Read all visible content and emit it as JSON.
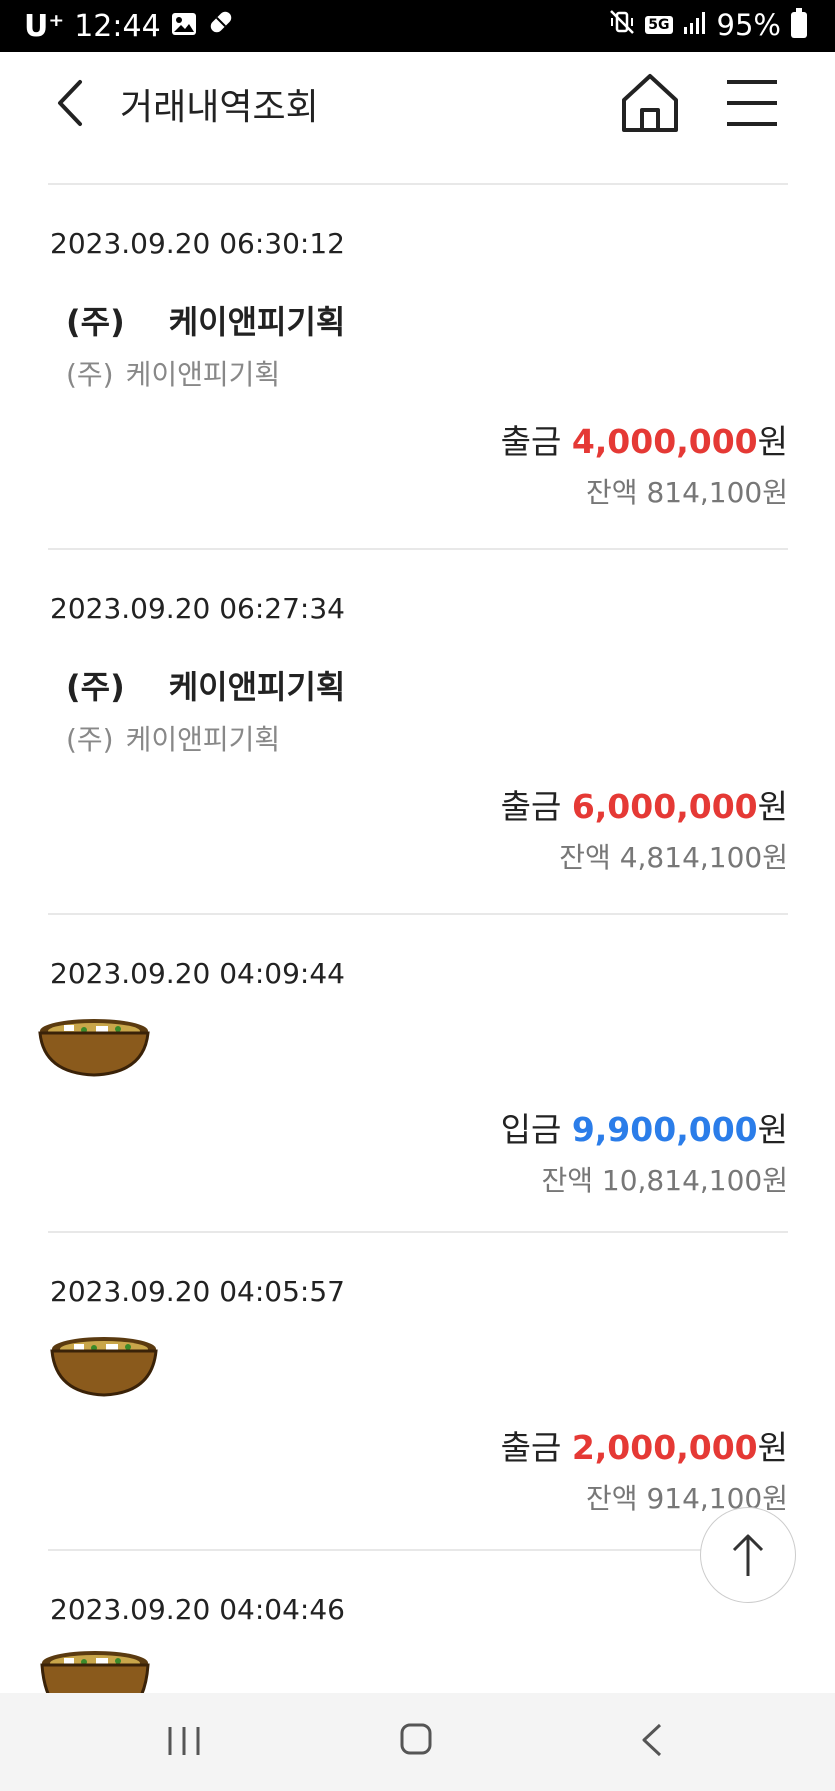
{
  "status_bar": {
    "carrier": "U⁺",
    "time": "12:44",
    "network": "5G",
    "battery": "95%"
  },
  "header": {
    "title": "거래내역조회"
  },
  "transactions": [
    {
      "datetime": "2023.09.20 06:30:12",
      "name_part1": "(주)",
      "name_part2": "케이앤피기획",
      "memo_part1": "(주)",
      "memo_part2": "케이앤피기획",
      "type": "출금",
      "amount": "4,000,000",
      "unit": "원",
      "balance_label": "잔액",
      "balance": "814,100",
      "balance_unit": "원"
    },
    {
      "datetime": "2023.09.20 06:27:34",
      "name_part1": "(주)",
      "name_part2": "케이앤피기획",
      "memo_part1": "(주)",
      "memo_part2": "케이앤피기획",
      "type": "출금",
      "amount": "6,000,000",
      "unit": "원",
      "balance_label": "잔액",
      "balance": "4,814,100",
      "balance_unit": "원"
    },
    {
      "datetime": "2023.09.20 04:09:44",
      "type": "입금",
      "amount": "9,900,000",
      "unit": "원",
      "balance_label": "잔액",
      "balance": "10,814,100",
      "balance_unit": "원"
    },
    {
      "datetime": "2023.09.20 04:05:57",
      "type": "출금",
      "amount": "2,000,000",
      "unit": "원",
      "balance_label": "잔액",
      "balance": "914,100",
      "balance_unit": "원"
    },
    {
      "datetime": "2023.09.20 04:04:46"
    }
  ],
  "colors": {
    "withdraw": "#e53935",
    "deposit": "#2b7de9",
    "divider": "#e8e8e8"
  },
  "icons": {
    "back": "chevron-left-icon",
    "home": "home-icon",
    "menu": "hamburger-menu-icon",
    "scroll_top": "arrow-up-icon",
    "redacted_name": "pot-sticker-icon"
  }
}
